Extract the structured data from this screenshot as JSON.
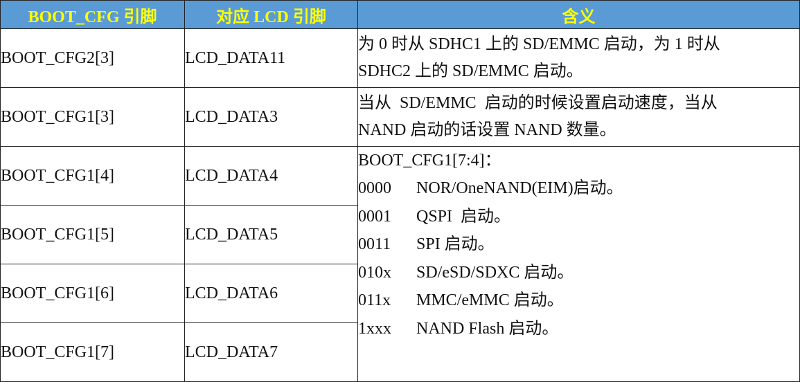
{
  "header": {
    "col1": "BOOT_CFG 引脚",
    "col2": "对应 LCD 引脚",
    "col3": "含义"
  },
  "rows": [
    {
      "pin": "BOOT_CFG2[3]",
      "lcd": "LCD_DATA11",
      "desc_line1": "为 0 时从 SDHC1 上的 SD/EMMC 启动，为 1 时从",
      "desc_line2": "SDHC2 上的 SD/EMMC 启动。"
    },
    {
      "pin": "BOOT_CFG1[3]",
      "lcd": "LCD_DATA3",
      "desc_line1": "当从  SD/EMMC  启动的时候设置启动速度，当从",
      "desc_line2": "NAND 启动的话设置 NAND 数量。"
    },
    {
      "pin": "BOOT_CFG1[4]",
      "lcd": "LCD_DATA4"
    },
    {
      "pin": "BOOT_CFG1[5]",
      "lcd": "LCD_DATA5"
    },
    {
      "pin": "BOOT_CFG1[6]",
      "lcd": "LCD_DATA6"
    },
    {
      "pin": "BOOT_CFG1[7]",
      "lcd": "LCD_DATA7"
    }
  ],
  "merged_desc": {
    "title": "BOOT_CFG1[7:4]：",
    "options": [
      {
        "code": "0000",
        "text": "NOR/OneNAND(EIM)启动。"
      },
      {
        "code": "0001",
        "text": "QSPI  启动。"
      },
      {
        "code": "0011",
        "text": "SPI 启动。"
      },
      {
        "code": "010x",
        "text": "SD/eSD/SDXC 启动。"
      },
      {
        "code": "011x",
        "text": "MMC/eMMC 启动。"
      },
      {
        "code": "1xxx",
        "text": "NAND Flash 启动。"
      }
    ]
  },
  "colors": {
    "header_bg": "#5a9bd5",
    "header_text": "#ffff00",
    "border": "#222222"
  }
}
